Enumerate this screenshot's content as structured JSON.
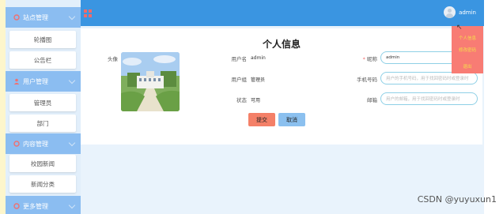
{
  "sidebar": {
    "groups": [
      {
        "label": "站点管理",
        "icon": "gear-icon"
      },
      {
        "label": "用户管理",
        "icon": "user-icon"
      },
      {
        "label": "内容管理",
        "icon": "gear-icon"
      },
      {
        "label": "更多管理",
        "icon": "gear-icon"
      }
    ],
    "items": [
      "轮播图",
      "公告栏",
      "管理员",
      "部门",
      "校园新闻",
      "新闻分类"
    ]
  },
  "header": {
    "logo_icon": "grid-logo-icon",
    "username": "admin"
  },
  "dropdown": {
    "items": [
      {
        "label": "个人信息",
        "color": "#f5e04a"
      },
      {
        "label": "修改密码",
        "color": "#f5e04a"
      },
      {
        "label": "退出",
        "color": "#f5e04a"
      }
    ]
  },
  "profile": {
    "title": "个人信息",
    "avatar_label": "头像",
    "username_label": "用户名",
    "username_value": "admin",
    "usergroup_label": "用户组",
    "usergroup_value": "管理员",
    "status_label": "状态",
    "status_value": "可用",
    "nickname_required": "*",
    "nickname_label": "昵称",
    "nickname_value": "admin",
    "phone_label": "手机号码",
    "phone_placeholder": "用户的手机号码，用于找回密码时或登录时",
    "email_label": "邮箱",
    "email_placeholder": "用户的邮箱，用于找回密码时或登录时",
    "submit_label": "提交",
    "cancel_label": "取消"
  },
  "watermark": "CSDN @yuyuxun1",
  "colors": {
    "header": "#3a95e1",
    "sidebar_group": "#8bbdf1",
    "dropdown": "#f87c74",
    "submit": "#f48068",
    "cancel": "#8bc0ef"
  }
}
